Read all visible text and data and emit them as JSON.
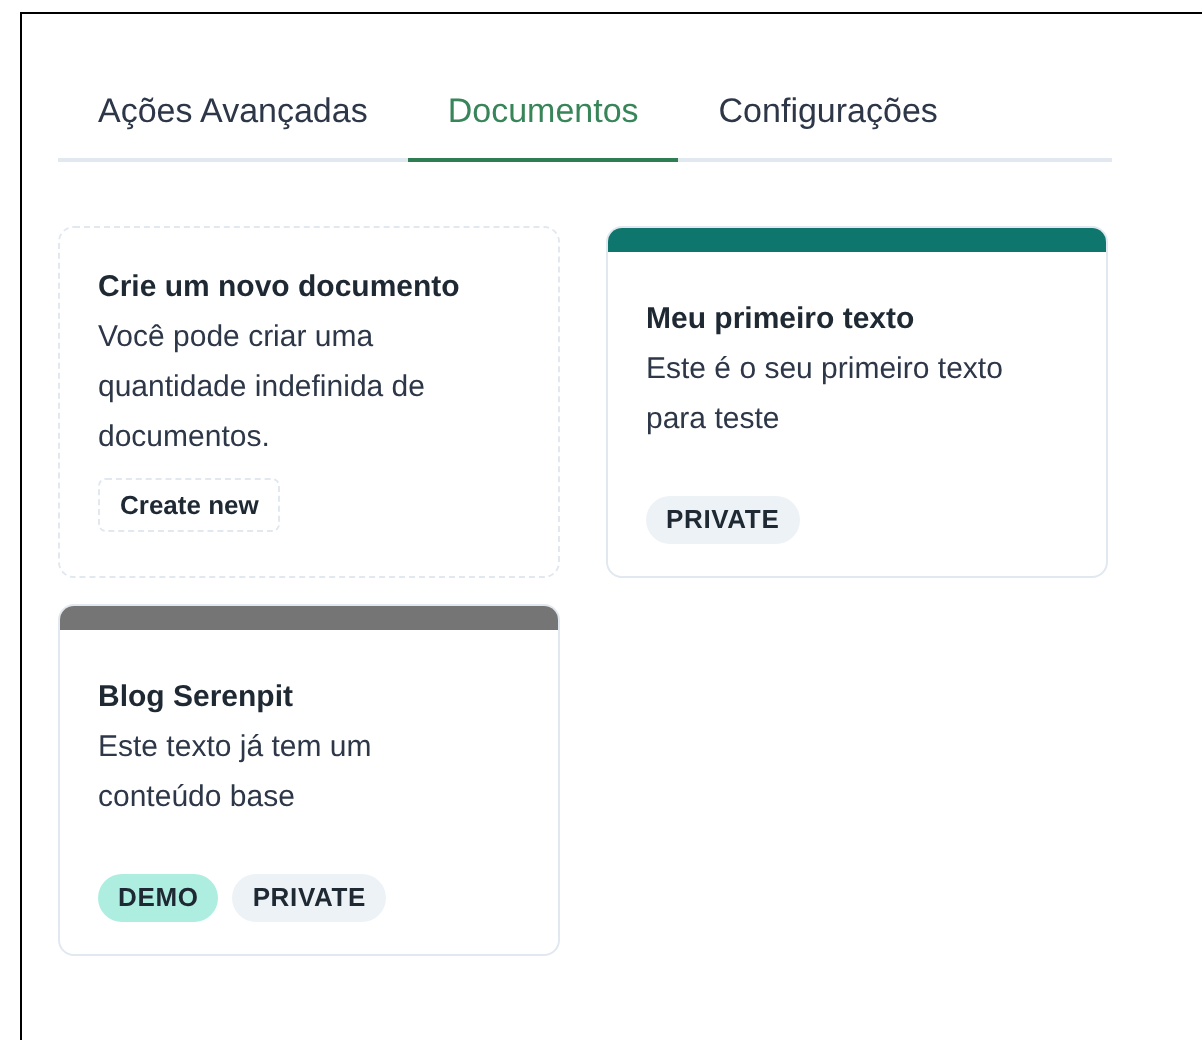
{
  "tabs": [
    {
      "label": "Ações Avançadas",
      "selected": false
    },
    {
      "label": "Documentos",
      "selected": true
    },
    {
      "label": "Configurações",
      "selected": false
    }
  ],
  "cards": [
    {
      "kind": "new",
      "title": "Crie um novo documento",
      "description": "Você pode criar uma quantidade indefinida de documentos.",
      "button": "Create new"
    },
    {
      "kind": "document",
      "color": "#0f766e",
      "title": "Meu primeiro texto",
      "description": "Este é o seu primeiro texto para teste",
      "tags": [
        {
          "label": "PRIVATE",
          "color": "#edf2f7"
        }
      ]
    },
    {
      "kind": "document",
      "color": "#757575",
      "title": "Blog Serenpit",
      "description": "Este texto já tem um conteúdo base",
      "tags": [
        {
          "label": "DEMO",
          "color": "#aeeee0"
        },
        {
          "label": "PRIVATE",
          "color": "#edf2f7"
        }
      ]
    }
  ]
}
